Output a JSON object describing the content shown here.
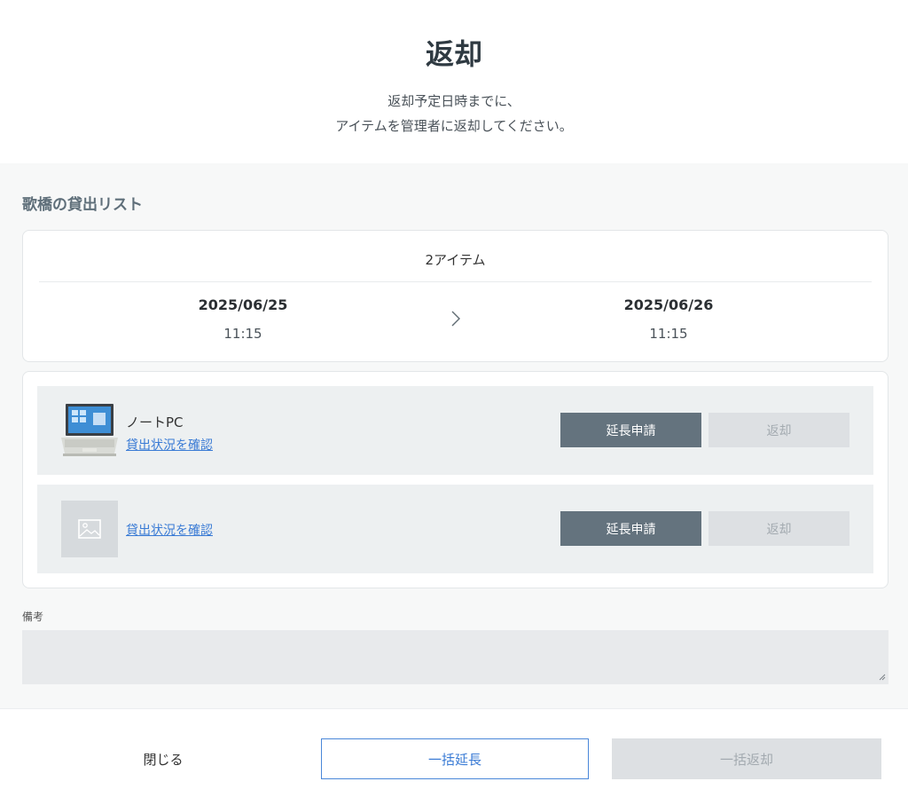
{
  "header": {
    "title": "返却",
    "desc_line1": "返却予定日時までに、",
    "desc_line2": "アイテムを管理者に返却してください。"
  },
  "list": {
    "title": "歌橋の貸出リスト",
    "item_count": "2アイテム",
    "start_date": "2025/06/25",
    "start_time": "11:15",
    "end_date": "2025/06/26",
    "end_time": "11:15",
    "arrow_icon": "chevron-right-icon"
  },
  "items": [
    {
      "name": "ノートPC",
      "thumbnail": "laptop-image",
      "status_link": "貸出状況を確認",
      "extend_label": "延長申請",
      "return_label": "返却"
    },
    {
      "name": "",
      "thumbnail": "image-placeholder-icon",
      "status_link": "貸出状況を確認",
      "extend_label": "延長申請",
      "return_label": "返却"
    }
  ],
  "notes": {
    "label": "備考",
    "value": ""
  },
  "footer": {
    "close_label": "閉じる",
    "bulk_extend_label": "一括延長",
    "bulk_return_label": "一括返却"
  },
  "colors": {
    "primary_button": "#64737e",
    "disabled_button": "#dde0e3",
    "link": "#3a7bd5",
    "background_section": "#f7f8f8"
  }
}
